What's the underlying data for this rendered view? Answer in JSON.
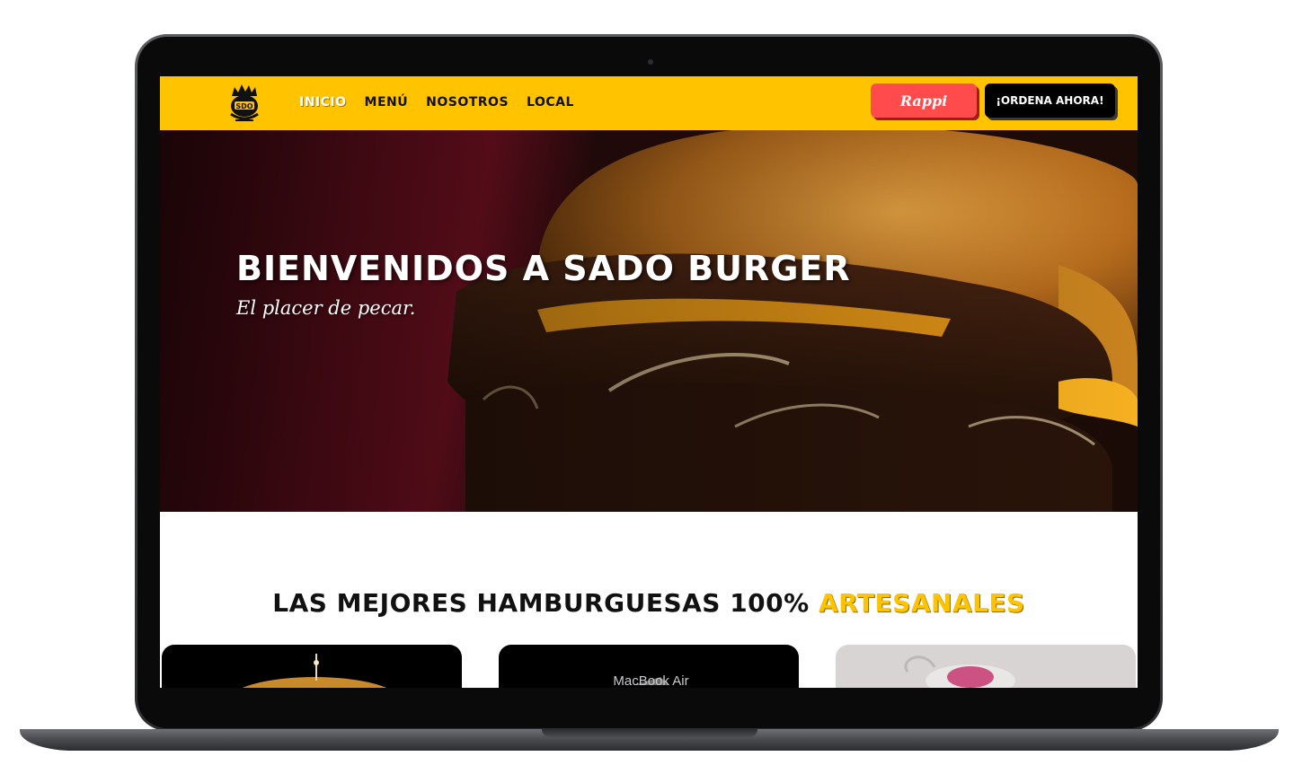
{
  "device": {
    "label": "MacBook Air"
  },
  "navbar": {
    "logo_icon": "sado-burger-logo",
    "menu": [
      {
        "label": "INICIO",
        "active": true
      },
      {
        "label": "MENÚ",
        "active": false
      },
      {
        "label": "NOSOTROS",
        "active": false
      },
      {
        "label": "LOCAL",
        "active": false
      }
    ],
    "rappi_label": "Rappi",
    "order_label": "¡ORDENA AHORA!"
  },
  "hero": {
    "title": "BIENVENIDOS A SADO BURGER",
    "subtitle": "El placer de pecar."
  },
  "section": {
    "title_prefix": "LAS MEJORES HAMBURGUESAS 100%",
    "title_accent": "ARTESANALES"
  },
  "colors": {
    "brand_yellow": "#ffc300",
    "rappi_red": "#ff4b4b",
    "black": "#000000"
  }
}
